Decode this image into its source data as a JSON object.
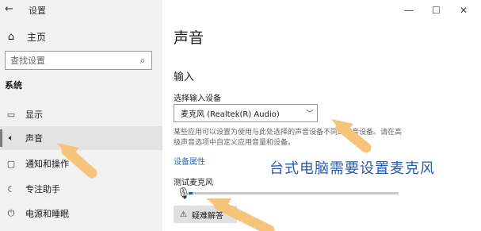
{
  "window": {
    "title": "设置",
    "back_icon": "back-arrow-icon",
    "minimize": "—",
    "maximize": "☐",
    "close": "✕"
  },
  "sidebar": {
    "home_label": "主页",
    "search_placeholder": "查找设置",
    "section_label": "系统",
    "items": [
      {
        "label": "显示",
        "icon": "display-icon",
        "active": false
      },
      {
        "label": "声音",
        "icon": "speaker-icon",
        "active": true
      },
      {
        "label": "通知和操作",
        "icon": "notification-icon",
        "active": false
      },
      {
        "label": "专注助手",
        "icon": "focus-assist-icon",
        "active": false
      },
      {
        "label": "电源和睡眠",
        "icon": "power-icon",
        "active": false
      }
    ]
  },
  "main": {
    "title": "声音",
    "input_section": "输入",
    "device_label": "选择输入设备",
    "selected_device": "麦克风 (Realtek(R) Audio)",
    "description_lines": [
      "某些应用可以设置为使用与此处选择的声音设备不同的声音设备。请在高",
      "级声音选项中自定义应用音量和设备。"
    ],
    "device_properties_link": "设备属性",
    "test_mic_label": "测试麦克风",
    "mic_level": 0.02,
    "troubleshoot_label": "疑难解答"
  },
  "annotation": {
    "caption": "台式电脑需要设置麦克风",
    "arrow_color": "#f5c47a"
  }
}
